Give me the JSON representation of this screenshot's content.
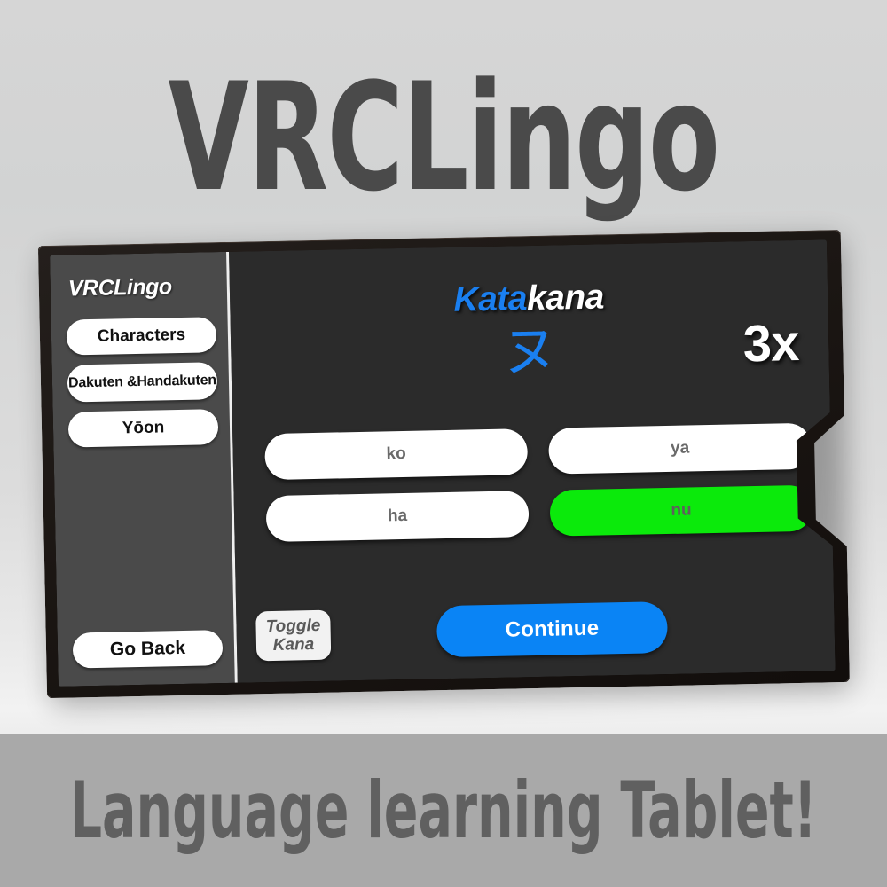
{
  "poster": {
    "top_title": "VRCLingo",
    "bottom_caption": "Language learning Tablet!",
    "background_color": "#d6d6d6",
    "banner_color": "#a9a9a9",
    "caption_text_color": "#606060"
  },
  "tablet": {
    "frame_color": "#1b1613",
    "screen_bg": "#2b2b2b"
  },
  "sidebar": {
    "title": "VRCLingo",
    "background_color": "#4a4a4a",
    "items": [
      {
        "label": "Characters"
      },
      {
        "label": "Dakuten & Handakuten",
        "line1": "Dakuten &",
        "line2": "Handakuten"
      },
      {
        "label": "Yōon"
      }
    ],
    "back_button": {
      "label": "Go Back"
    }
  },
  "main": {
    "lesson_title": {
      "highlight": "Kata",
      "rest": "kana",
      "highlight_color": "#1a7ff0",
      "rest_color": "#ffffff"
    },
    "kana_character": "ヌ",
    "kana_color": "#1a7ff0",
    "streak": "3x",
    "answers": [
      {
        "label": "ko",
        "state": "default"
      },
      {
        "label": "ya",
        "state": "default"
      },
      {
        "label": "ha",
        "state": "default"
      },
      {
        "label": "nu",
        "state": "correct"
      }
    ],
    "correct_color": "#0bea0b",
    "toggle_kana": {
      "line1": "Toggle",
      "line2": "Kana"
    },
    "continue_button": {
      "label": "Continue",
      "color": "#0a84f5"
    }
  }
}
